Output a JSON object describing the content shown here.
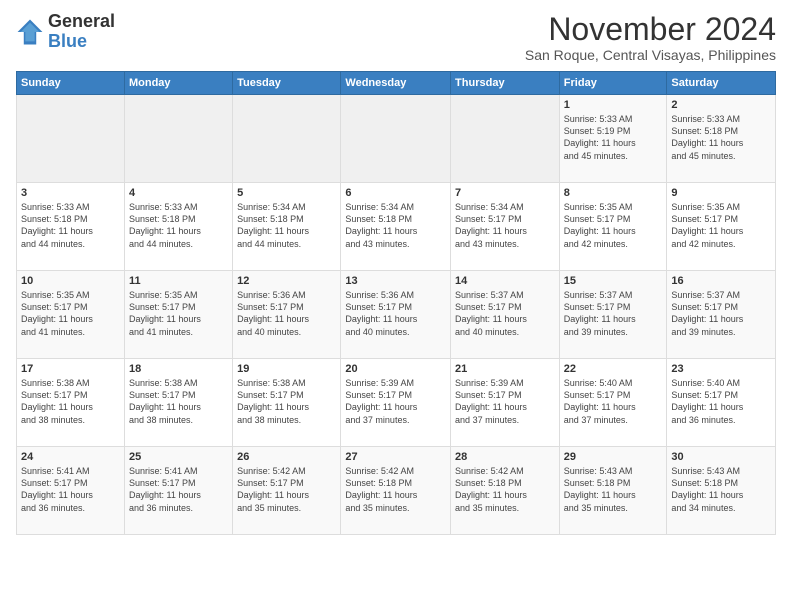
{
  "header": {
    "logo_general": "General",
    "logo_blue": "Blue",
    "title": "November 2024",
    "subtitle": "San Roque, Central Visayas, Philippines"
  },
  "calendar": {
    "headers": [
      "Sunday",
      "Monday",
      "Tuesday",
      "Wednesday",
      "Thursday",
      "Friday",
      "Saturday"
    ],
    "weeks": [
      [
        {
          "day": "",
          "info": ""
        },
        {
          "day": "",
          "info": ""
        },
        {
          "day": "",
          "info": ""
        },
        {
          "day": "",
          "info": ""
        },
        {
          "day": "",
          "info": ""
        },
        {
          "day": "1",
          "info": "Sunrise: 5:33 AM\nSunset: 5:19 PM\nDaylight: 11 hours\nand 45 minutes."
        },
        {
          "day": "2",
          "info": "Sunrise: 5:33 AM\nSunset: 5:18 PM\nDaylight: 11 hours\nand 45 minutes."
        }
      ],
      [
        {
          "day": "3",
          "info": "Sunrise: 5:33 AM\nSunset: 5:18 PM\nDaylight: 11 hours\nand 44 minutes."
        },
        {
          "day": "4",
          "info": "Sunrise: 5:33 AM\nSunset: 5:18 PM\nDaylight: 11 hours\nand 44 minutes."
        },
        {
          "day": "5",
          "info": "Sunrise: 5:34 AM\nSunset: 5:18 PM\nDaylight: 11 hours\nand 44 minutes."
        },
        {
          "day": "6",
          "info": "Sunrise: 5:34 AM\nSunset: 5:18 PM\nDaylight: 11 hours\nand 43 minutes."
        },
        {
          "day": "7",
          "info": "Sunrise: 5:34 AM\nSunset: 5:17 PM\nDaylight: 11 hours\nand 43 minutes."
        },
        {
          "day": "8",
          "info": "Sunrise: 5:35 AM\nSunset: 5:17 PM\nDaylight: 11 hours\nand 42 minutes."
        },
        {
          "day": "9",
          "info": "Sunrise: 5:35 AM\nSunset: 5:17 PM\nDaylight: 11 hours\nand 42 minutes."
        }
      ],
      [
        {
          "day": "10",
          "info": "Sunrise: 5:35 AM\nSunset: 5:17 PM\nDaylight: 11 hours\nand 41 minutes."
        },
        {
          "day": "11",
          "info": "Sunrise: 5:35 AM\nSunset: 5:17 PM\nDaylight: 11 hours\nand 41 minutes."
        },
        {
          "day": "12",
          "info": "Sunrise: 5:36 AM\nSunset: 5:17 PM\nDaylight: 11 hours\nand 40 minutes."
        },
        {
          "day": "13",
          "info": "Sunrise: 5:36 AM\nSunset: 5:17 PM\nDaylight: 11 hours\nand 40 minutes."
        },
        {
          "day": "14",
          "info": "Sunrise: 5:37 AM\nSunset: 5:17 PM\nDaylight: 11 hours\nand 40 minutes."
        },
        {
          "day": "15",
          "info": "Sunrise: 5:37 AM\nSunset: 5:17 PM\nDaylight: 11 hours\nand 39 minutes."
        },
        {
          "day": "16",
          "info": "Sunrise: 5:37 AM\nSunset: 5:17 PM\nDaylight: 11 hours\nand 39 minutes."
        }
      ],
      [
        {
          "day": "17",
          "info": "Sunrise: 5:38 AM\nSunset: 5:17 PM\nDaylight: 11 hours\nand 38 minutes."
        },
        {
          "day": "18",
          "info": "Sunrise: 5:38 AM\nSunset: 5:17 PM\nDaylight: 11 hours\nand 38 minutes."
        },
        {
          "day": "19",
          "info": "Sunrise: 5:38 AM\nSunset: 5:17 PM\nDaylight: 11 hours\nand 38 minutes."
        },
        {
          "day": "20",
          "info": "Sunrise: 5:39 AM\nSunset: 5:17 PM\nDaylight: 11 hours\nand 37 minutes."
        },
        {
          "day": "21",
          "info": "Sunrise: 5:39 AM\nSunset: 5:17 PM\nDaylight: 11 hours\nand 37 minutes."
        },
        {
          "day": "22",
          "info": "Sunrise: 5:40 AM\nSunset: 5:17 PM\nDaylight: 11 hours\nand 37 minutes."
        },
        {
          "day": "23",
          "info": "Sunrise: 5:40 AM\nSunset: 5:17 PM\nDaylight: 11 hours\nand 36 minutes."
        }
      ],
      [
        {
          "day": "24",
          "info": "Sunrise: 5:41 AM\nSunset: 5:17 PM\nDaylight: 11 hours\nand 36 minutes."
        },
        {
          "day": "25",
          "info": "Sunrise: 5:41 AM\nSunset: 5:17 PM\nDaylight: 11 hours\nand 36 minutes."
        },
        {
          "day": "26",
          "info": "Sunrise: 5:42 AM\nSunset: 5:17 PM\nDaylight: 11 hours\nand 35 minutes."
        },
        {
          "day": "27",
          "info": "Sunrise: 5:42 AM\nSunset: 5:18 PM\nDaylight: 11 hours\nand 35 minutes."
        },
        {
          "day": "28",
          "info": "Sunrise: 5:42 AM\nSunset: 5:18 PM\nDaylight: 11 hours\nand 35 minutes."
        },
        {
          "day": "29",
          "info": "Sunrise: 5:43 AM\nSunset: 5:18 PM\nDaylight: 11 hours\nand 35 minutes."
        },
        {
          "day": "30",
          "info": "Sunrise: 5:43 AM\nSunset: 5:18 PM\nDaylight: 11 hours\nand 34 minutes."
        }
      ]
    ]
  }
}
